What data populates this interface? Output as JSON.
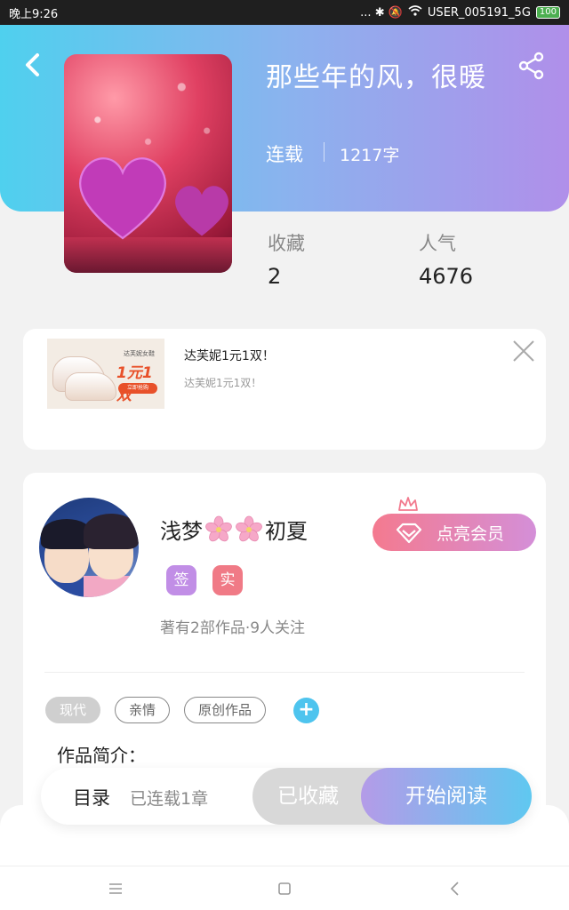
{
  "status_bar": {
    "time": "晚上9:26",
    "indicators": "... ✱ 🔕",
    "network": "USER_005191_5G",
    "battery": "100"
  },
  "book": {
    "title": "那些年的风，很暖",
    "status": "连载",
    "words": "1217字",
    "stats": [
      {
        "label": "收藏",
        "value": "2"
      },
      {
        "label": "人气",
        "value": "4676"
      }
    ]
  },
  "ad": {
    "title": "达芙妮1元1双！",
    "subtitle": "达芙妮1元1双！",
    "image_brand": "达芙妮女鞋",
    "image_price": "1元1双",
    "image_button": "立即抢购"
  },
  "author": {
    "name": "浅梦",
    "name_suffix": "初夏",
    "badges": [
      {
        "label": "签",
        "color": "#c18ee6"
      },
      {
        "label": "实",
        "color": "#f07a86"
      }
    ],
    "meta": "著有2部作品·9人关注",
    "vip_button": "点亮会员"
  },
  "tags": [
    {
      "label": "现代",
      "style": "grey"
    },
    {
      "label": "亲情",
      "style": "outline"
    },
    {
      "label": "原创作品",
      "style": "outline"
    }
  ],
  "intro": {
    "title": "作品简介："
  },
  "action_bar": {
    "toc_label": "目录",
    "toc_sub": "已连载1章",
    "collected": "已收藏",
    "read": "开始阅读"
  },
  "colors": {
    "header_start": "#4fd0ee",
    "header_end": "#b08fea",
    "accent_blue": "#4ec4ee"
  }
}
